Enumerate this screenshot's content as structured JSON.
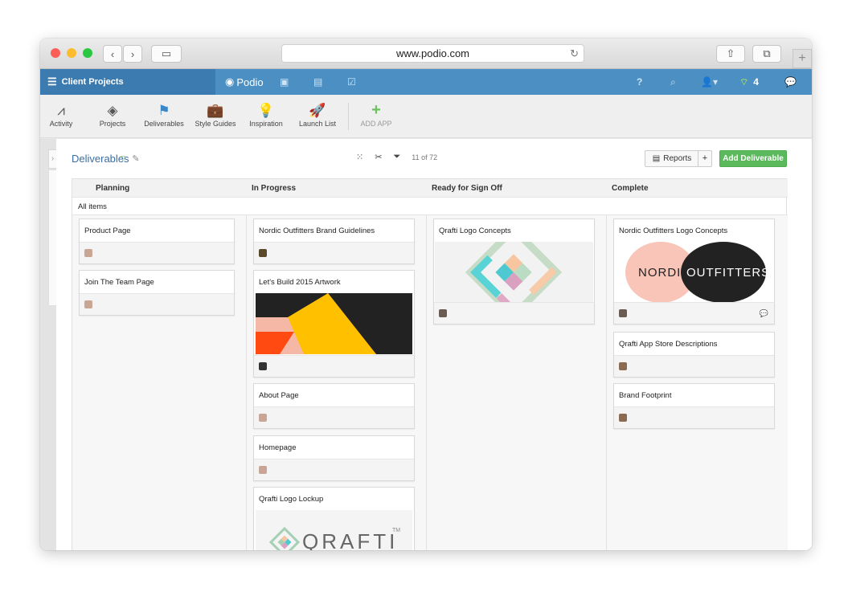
{
  "browser": {
    "url": "www.podio.com"
  },
  "topbar": {
    "workspace": "Client Projects",
    "brand": "Podio",
    "help": "?",
    "notifications_count": "4"
  },
  "apps": [
    {
      "label": "Activity",
      "icon": "activity-icon"
    },
    {
      "label": "Projects",
      "icon": "diamond-icon"
    },
    {
      "label": "Deliverables",
      "icon": "flag-icon"
    },
    {
      "label": "Style Guides",
      "icon": "briefcase-icon"
    },
    {
      "label": "Inspiration",
      "icon": "bulb-icon"
    },
    {
      "label": "Launch List",
      "icon": "rocket-icon"
    },
    {
      "label": "ADD APP",
      "icon": "plus-icon"
    }
  ],
  "header": {
    "title": "Deliverables",
    "filter_count": "11 of 72",
    "reports_label": "Reports",
    "plus_label": "+",
    "add_label": "Add Deliverable"
  },
  "board": {
    "all_items_label": "All items",
    "columns": [
      {
        "title": "Planning",
        "cards": [
          {
            "title": "Product Page"
          },
          {
            "title": "Join The Team Page"
          }
        ]
      },
      {
        "title": "In Progress",
        "cards": [
          {
            "title": "Nordic Outfitters Brand Guidelines"
          },
          {
            "title": "Let's Build 2015 Artwork"
          },
          {
            "title": "About Page"
          },
          {
            "title": "Homepage"
          },
          {
            "title": "Qrafti Logo Lockup"
          }
        ]
      },
      {
        "title": "Ready for Sign Off",
        "cards": [
          {
            "title": "Qrafti Logo Concepts"
          }
        ]
      },
      {
        "title": "Complete",
        "cards": [
          {
            "title": "Nordic Outfitters Logo Concepts"
          },
          {
            "title": "Qrafti App Store Descriptions"
          },
          {
            "title": "Brand Footprint"
          }
        ]
      }
    ]
  },
  "logos": {
    "nordic_left": "NORDIC",
    "nordic_right": "OUTFITTERS",
    "qrafti": "QRAFTI",
    "qrafti_tm": "TM"
  },
  "colors": {
    "topbar": "#4b8fc3",
    "add_button": "#5cb85c",
    "title_link": "#3a6ea5"
  }
}
